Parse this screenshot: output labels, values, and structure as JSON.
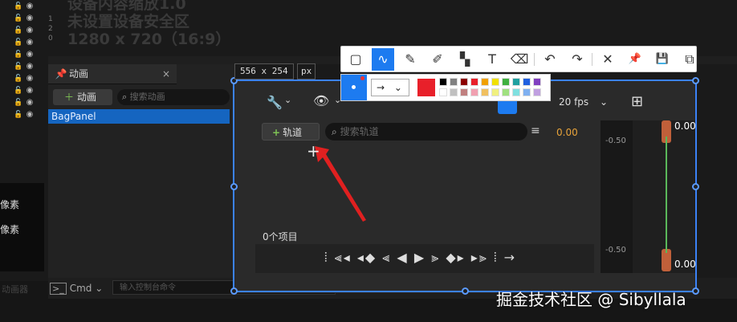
{
  "background_text": {
    "line1": "设备内容缩放1.0",
    "line2": "未设置设备安全区",
    "line3": "1280 x 720（16:9）"
  },
  "ruler": {
    "ticks": [
      "1",
      "2",
      "0"
    ]
  },
  "layers": {
    "rows": 10
  },
  "animation_panel": {
    "tab_label": "动画",
    "close": "×",
    "add_button": "动画",
    "search_placeholder": "搜索动画",
    "items": [
      "BagPanel"
    ]
  },
  "left_panel": {
    "label1": "像素",
    "label2": "像素",
    "faded": "动画器"
  },
  "command_bar": {
    "label": "Cmd",
    "input_placeholder": "输入控制台命令"
  },
  "timeline": {
    "fps": "20 fps",
    "add_track": "轨道",
    "search_placeholder": "搜索轨道",
    "time": "0.00",
    "items_count": "0个项目",
    "curve_top_value": "0.00",
    "curve_bottom_value": "0.00",
    "curve_tick_upper": "-0.50",
    "curve_tick_lower": "-0.50"
  },
  "screenshot_tool": {
    "size": "556 x 254",
    "unit": "px",
    "toolbar": [
      {
        "name": "rect-tool-icon",
        "glyph": "▢"
      },
      {
        "name": "polyline-tool-icon",
        "glyph": "∿"
      },
      {
        "name": "pen-tool-icon",
        "glyph": "✎"
      },
      {
        "name": "marker-tool-icon",
        "glyph": "✐"
      },
      {
        "name": "mosaic-tool-icon",
        "glyph": "▚"
      },
      {
        "name": "text-tool-icon",
        "glyph": "T"
      },
      {
        "name": "eraser-tool-icon",
        "glyph": "⌫"
      },
      {
        "name": "undo-icon",
        "glyph": "↶"
      },
      {
        "name": "redo-icon",
        "glyph": "↷"
      },
      {
        "name": "close-icon",
        "glyph": "✕"
      },
      {
        "name": "pin-icon",
        "glyph": "📌"
      },
      {
        "name": "save-icon",
        "glyph": "💾"
      },
      {
        "name": "copy-icon",
        "glyph": "⧉"
      }
    ],
    "arrow_style": "→",
    "current_color": "#e8202a",
    "palette": [
      "#000000",
      "#808080",
      "#8b0000",
      "#e8202a",
      "#f0a000",
      "#f0e000",
      "#40b040",
      "#20a0a0",
      "#2060e0",
      "#8040c0",
      "#ffffff",
      "#c0c0c0",
      "#c08080",
      "#f0a0b0",
      "#f0c060",
      "#f0f080",
      "#a0e080",
      "#80e0e0",
      "#80b0f0",
      "#c0a0e0"
    ]
  },
  "watermark": "掘金技术社区 @ Sibyllala"
}
